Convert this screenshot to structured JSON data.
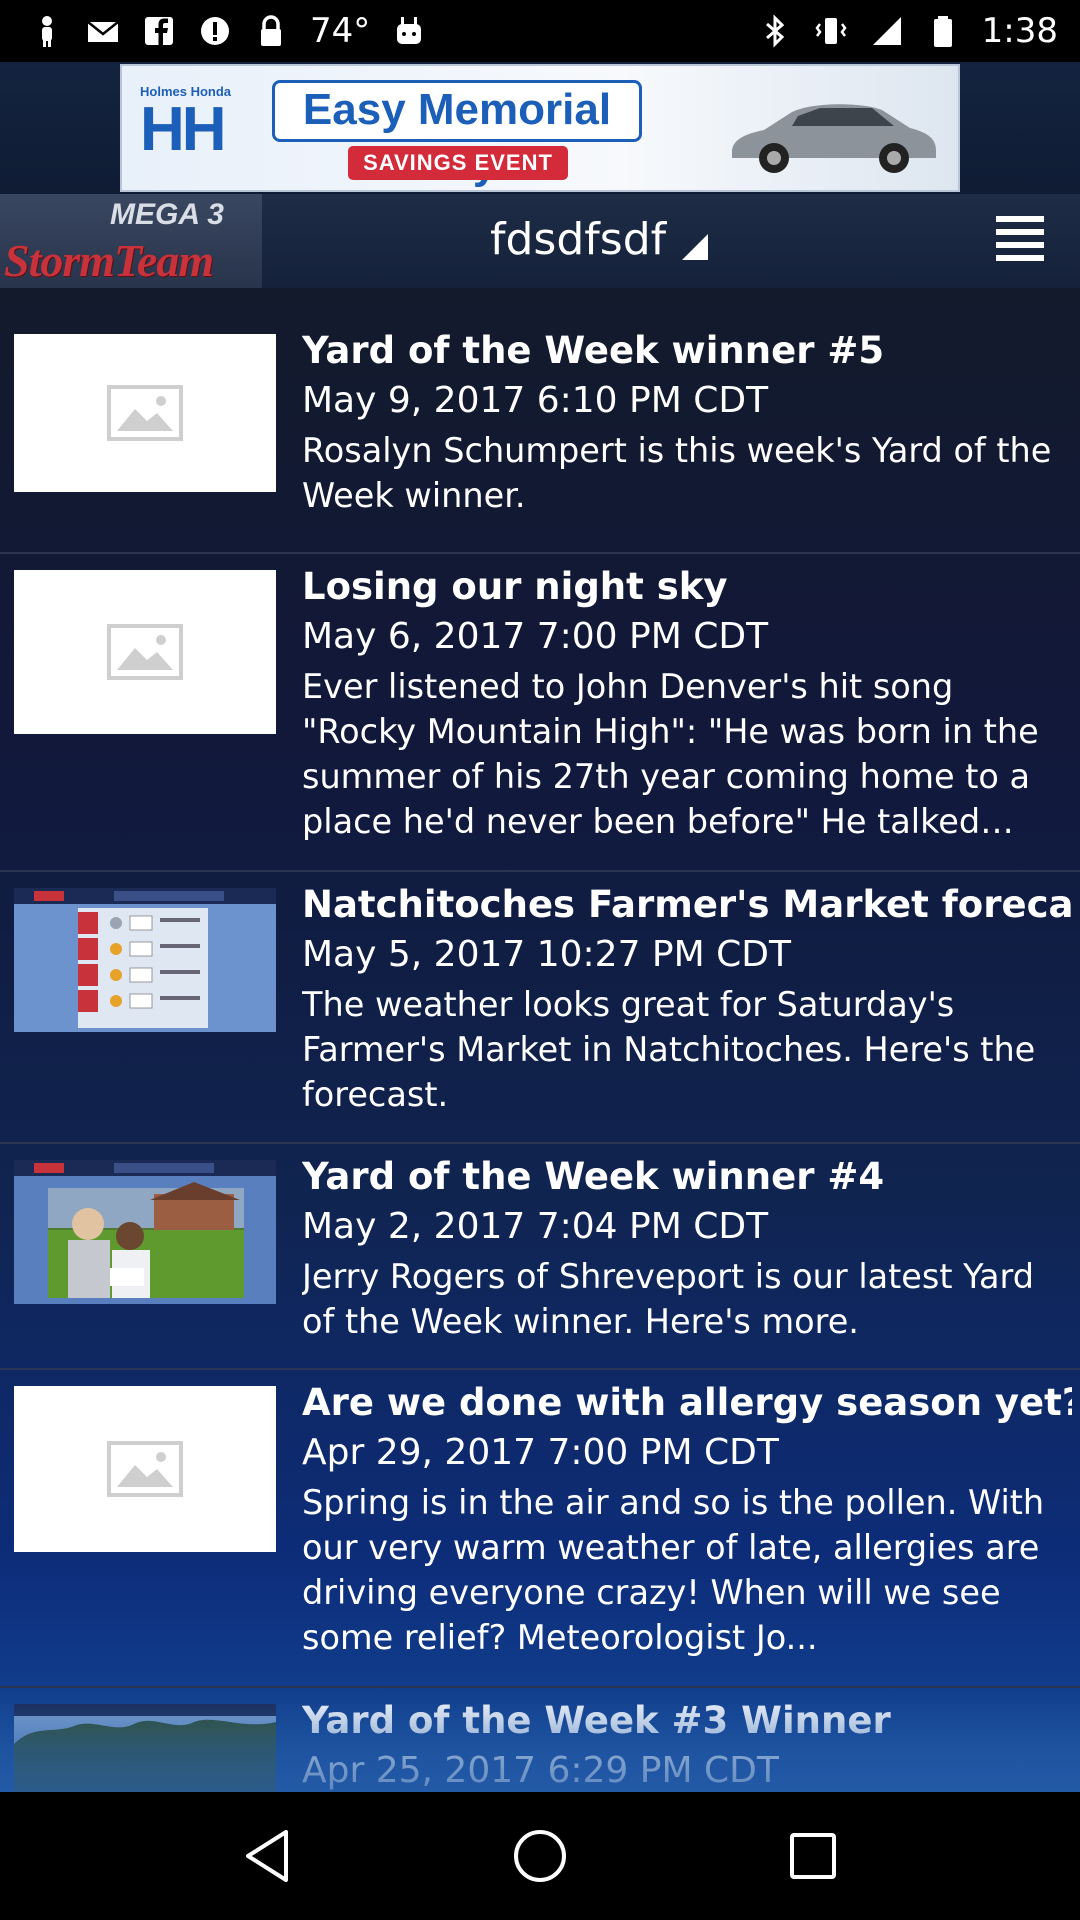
{
  "status_bar": {
    "temperature": "74°",
    "time": "1:38"
  },
  "ad": {
    "brand_top": "Holmes Honda",
    "brand_letters": "HH",
    "headline": "Easy Memorial Day",
    "subline": "SAVINGS EVENT"
  },
  "header": {
    "logo_top": "MEGA 3",
    "logo_bottom": "StormTeam",
    "location": "fdsdfsdf"
  },
  "articles": [
    {
      "title": "Yard of the Week winner #5",
      "date": "May 9, 2017 6:10 PM CDT",
      "summary": "Rosalyn Schumpert is this week's Yard of the Week winner.",
      "thumbnail": "placeholder-image-icon"
    },
    {
      "title": "Losing our night sky",
      "date": "May 6, 2017 7:00 PM CDT",
      "summary": "Ever listened to John Denver's hit song \"Rocky Mountain High\": \"He was born in the summer of his 27th year coming home to a place he'd never been before\" He talked about seeing the stars in the night sky.",
      "thumbnail": "placeholder-image-icon"
    },
    {
      "title": "Natchitoches Farmer's Market forecast",
      "date": "May 5, 2017 10:27 PM CDT",
      "summary": "The weather looks great for Saturday's Farmer's Market in Natchitoches. Here's the forecast.",
      "thumbnail": "forecast-graphic"
    },
    {
      "title": "Yard of the Week winner #4",
      "date": "May 2, 2017 7:04 PM CDT",
      "summary": "Jerry Rogers of Shreveport is our latest Yard of the Week winner. Here's more.",
      "thumbnail": "yard-photo"
    },
    {
      "title": "Are we done with allergy season yet?",
      "date": "Apr 29, 2017 7:00 PM CDT",
      "summary": "Spring is in the air and so is the pollen. With our very warm weather of late, allergies are driving everyone crazy! When will we see some relief? Meteorologist Jo...",
      "thumbnail": "placeholder-image-icon"
    },
    {
      "title": "Yard of the Week #3 Winner",
      "date": "Apr 25, 2017 6:29 PM CDT",
      "summary": "",
      "thumbnail": "trees-photo"
    }
  ],
  "colors": {
    "feed_top": "#131a2c",
    "feed_bottom": "#134a9a",
    "ad_blue": "#1c5fb8",
    "ad_red": "#d42b3a",
    "logo_red": "#c8323a"
  }
}
